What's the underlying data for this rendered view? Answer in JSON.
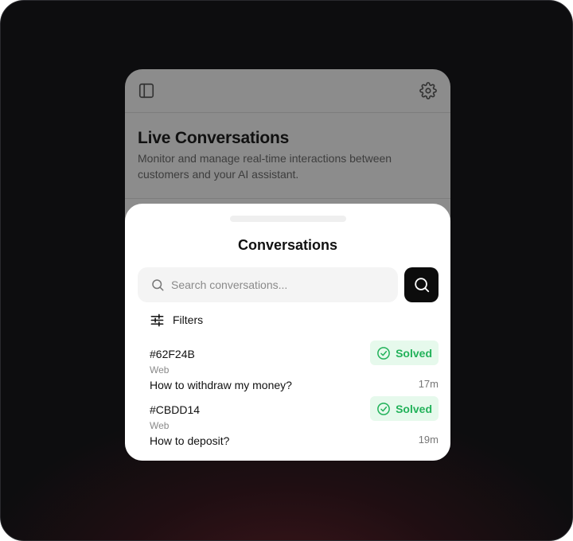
{
  "background_app": {
    "title": "Live Conversations",
    "description": "Monitor and manage real-time interactions between customers and your AI assistant."
  },
  "sheet": {
    "title": "Conversations",
    "search_placeholder": "Search conversations...",
    "filters_label": "Filters"
  },
  "conversations": [
    {
      "id": "#62F24B",
      "channel": "Web",
      "question": "How to withdraw my money?",
      "status": "Solved",
      "time": "17m"
    },
    {
      "id": "#CBDD14",
      "channel": "Web",
      "question": "How to deposit?",
      "status": "Solved",
      "time": "19m"
    }
  ],
  "colors": {
    "status_solved_text": "#22b25a",
    "status_solved_bg": "#e6f9ec",
    "search_button_bg": "#0c0c0c"
  },
  "icons": [
    "sidebar-icon",
    "gear-icon",
    "search-icon",
    "filters-icon",
    "check-circle-icon"
  ]
}
